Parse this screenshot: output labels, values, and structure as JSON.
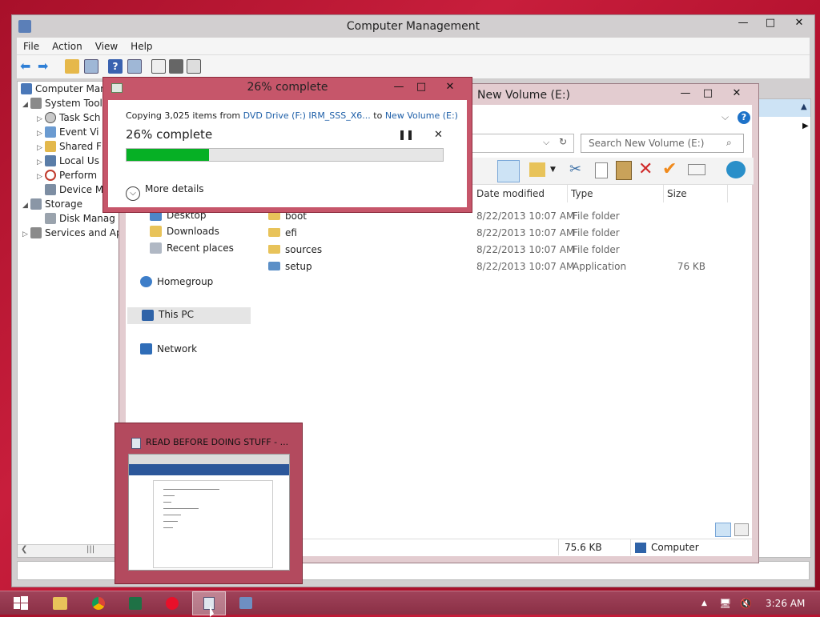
{
  "computer_management": {
    "title": "Computer Management",
    "menu": [
      "File",
      "Action",
      "View",
      "Help"
    ],
    "tree": [
      {
        "label": "Computer Mana",
        "icon": "computer-icon"
      },
      {
        "label": "System Tool",
        "icon": "tools-icon"
      },
      {
        "label": "Task Sch",
        "icon": "clock-icon"
      },
      {
        "label": "Event Vi",
        "icon": "event-viewer-icon"
      },
      {
        "label": "Shared F",
        "icon": "shared-folder-icon"
      },
      {
        "label": "Local Us",
        "icon": "users-icon"
      },
      {
        "label": "Perform",
        "icon": "performance-icon"
      },
      {
        "label": "Device M",
        "icon": "device-manager-icon"
      },
      {
        "label": "Storage",
        "icon": "storage-icon"
      },
      {
        "label": "Disk Manag",
        "icon": "disk-icon"
      },
      {
        "label": "Services and Ap",
        "icon": "services-icon"
      }
    ]
  },
  "explorer": {
    "title": "New Volume (E:)",
    "search_placeholder": "Search New Volume (E:)",
    "columns": {
      "date": "Date modified",
      "type": "Type",
      "size": "Size"
    },
    "nav": [
      {
        "label": "Desktop",
        "icon": "desktop-icon"
      },
      {
        "label": "Downloads",
        "icon": "downloads-icon"
      },
      {
        "label": "Recent places",
        "icon": "recent-icon"
      },
      {
        "label": "Homegroup",
        "icon": "homegroup-icon"
      },
      {
        "label": "This PC",
        "icon": "pc-icon"
      },
      {
        "label": "Network",
        "icon": "network-icon"
      }
    ],
    "files": [
      {
        "name": "boot",
        "date": "8/22/2013 10:07 AM",
        "type": "File folder",
        "size": ""
      },
      {
        "name": "efi",
        "date": "8/22/2013 10:07 AM",
        "type": "File folder",
        "size": ""
      },
      {
        "name": "sources",
        "date": "8/22/2013 10:07 AM",
        "type": "File folder",
        "size": ""
      },
      {
        "name": "setup",
        "date": "8/22/2013 10:07 AM",
        "type": "Application",
        "size": "76 KB"
      }
    ],
    "status_size": "75.6 KB",
    "status_location": "Computer"
  },
  "copy_dialog": {
    "title": "26% complete",
    "prefix": "Copying 3,025 items from ",
    "source": "DVD Drive (F:) IRM_SSS_X6...",
    "mid": " to ",
    "dest": "New Volume (E:)",
    "progress_label": "26% complete",
    "progress_fraction": 0.26,
    "more_details": "More details"
  },
  "taskbar_preview": {
    "title": "READ BEFORE DOING STUFF - ..."
  },
  "taskbar": {
    "clock": "3:26 AM"
  },
  "colors": {
    "accent": "#c6566a",
    "progress": "#06b025"
  }
}
